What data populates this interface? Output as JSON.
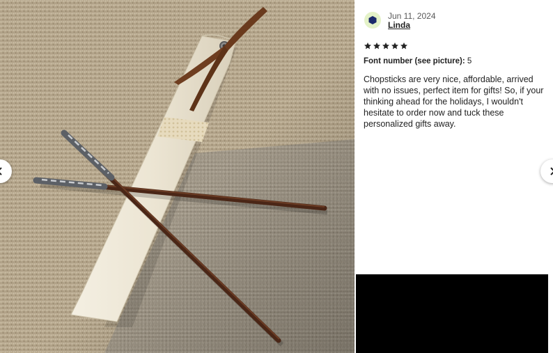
{
  "review": {
    "date": "Jun 11, 2024",
    "reviewer": "Linda",
    "rating": 5,
    "variation_label": "Font number (see picture):",
    "variation_value": "5",
    "text": "Chopsticks are very nice, affordable, arrived with no issues, perfect item for gifts! So, if your thinking ahead for the holidays, I wouldn't hesitate to order now and tuck these personalized gifts away."
  },
  "navigation": {
    "prev_icon": "chevron-left-icon",
    "next_icon": "chevron-right-icon"
  },
  "colors": {
    "star": "#222222",
    "avatar_bg": "#e4f2c8",
    "avatar_icon": "#1b2a6b",
    "video_bg": "#000000"
  }
}
